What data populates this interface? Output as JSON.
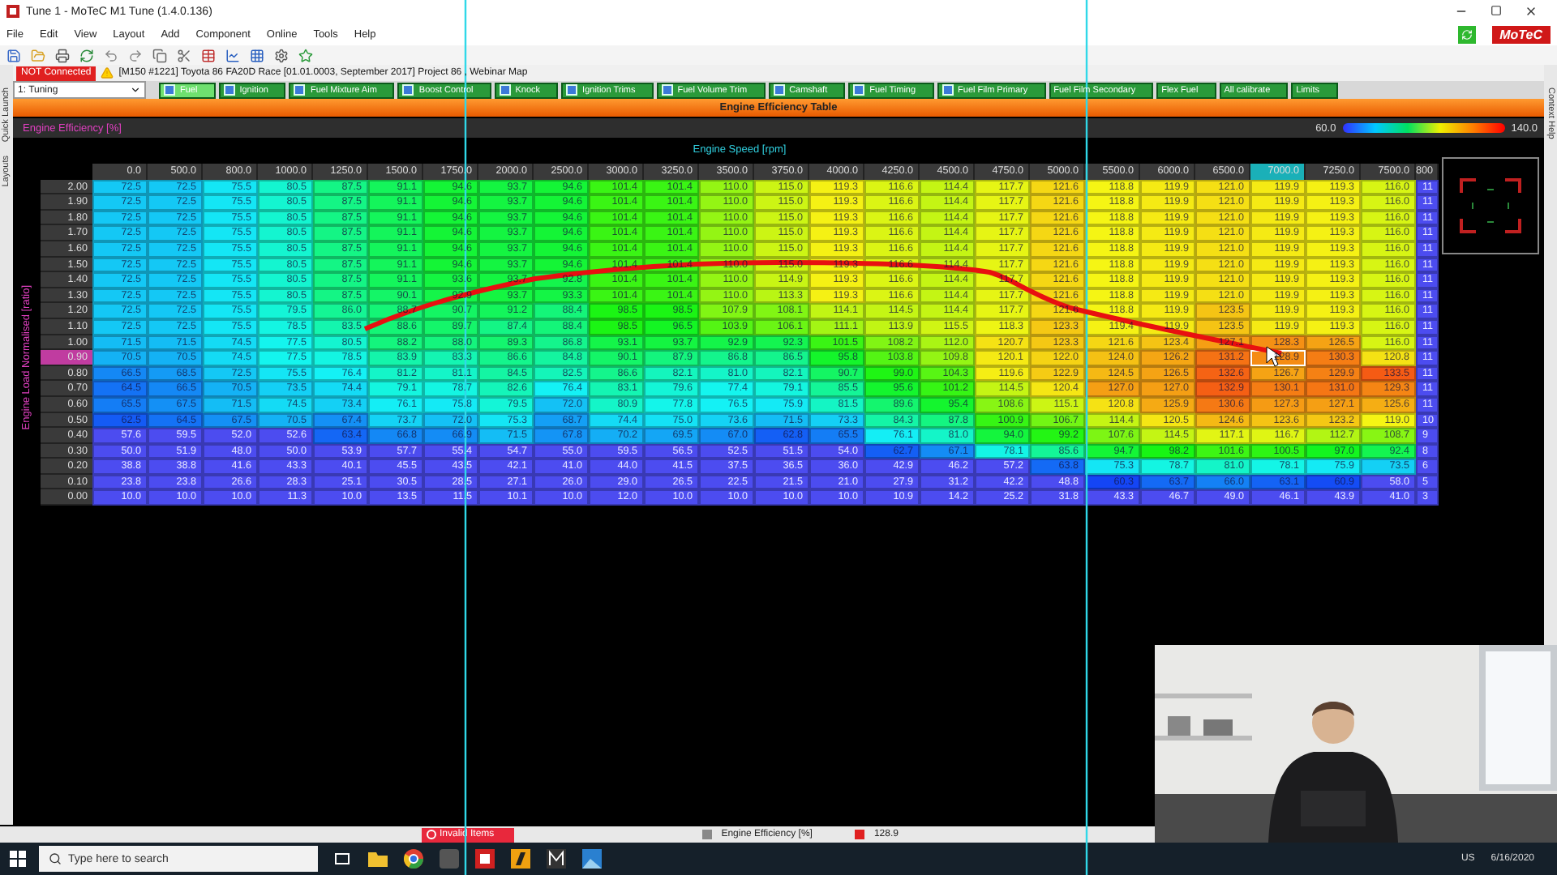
{
  "window": {
    "title": "Tune 1 - MoTeC M1 Tune (1.4.0.136)"
  },
  "menu": [
    "File",
    "Edit",
    "View",
    "Layout",
    "Add",
    "Component",
    "Online",
    "Tools",
    "Help"
  ],
  "brand": "MoTeC",
  "connection": {
    "status": "NOT Connected",
    "details": "[M150 #1221]  Toyota 86 FA20D Race [01.01.0003, September 2017] Project 86 , Webinar Map"
  },
  "side_tabs_left": [
    "Quick Launch",
    "Layouts"
  ],
  "side_tabs_right": [
    "Context Help"
  ],
  "workbook": {
    "value": "1: Tuning"
  },
  "tabs": [
    {
      "label": "Fuel",
      "selected": true,
      "icon": true
    },
    {
      "label": "Ignition",
      "selected": false,
      "icon": true
    },
    {
      "label": "Fuel Mixture Aim",
      "selected": false,
      "icon": true
    },
    {
      "label": "Boost Control",
      "selected": false,
      "icon": true
    },
    {
      "label": "Knock",
      "selected": false,
      "icon": true
    },
    {
      "label": "Ignition Trims",
      "selected": false,
      "icon": true
    },
    {
      "label": "Fuel Volume Trim",
      "selected": false,
      "icon": true
    },
    {
      "label": "Camshaft",
      "selected": false,
      "icon": true
    },
    {
      "label": "Fuel Timing",
      "selected": false,
      "icon": true
    },
    {
      "label": "Fuel Film Primary",
      "selected": false,
      "icon": true
    },
    {
      "label": "Fuel Film Secondary",
      "selected": false,
      "icon": false
    },
    {
      "label": "Flex Fuel",
      "selected": false,
      "icon": false
    },
    {
      "label": "All calibrate",
      "selected": false,
      "icon": false
    },
    {
      "label": "Limits",
      "selected": false,
      "icon": false
    }
  ],
  "table": {
    "title": "Engine Efficiency Table",
    "name": "Engine Efficiency [%]",
    "scale_min": "60.0",
    "scale_max": "140.0",
    "x_axis": "Engine Speed [rpm]",
    "y_axis": "Engine Load Normalised [ratio]",
    "columns": [
      {
        "label": "0.0",
        "selected": false
      },
      {
        "label": "500.0",
        "selected": false
      },
      {
        "label": "800.0",
        "selected": false
      },
      {
        "label": "1000.0",
        "selected": false
      },
      {
        "label": "1250.0",
        "selected": false
      },
      {
        "label": "1500.0",
        "selected": false
      },
      {
        "label": "1750.0",
        "selected": false
      },
      {
        "label": "2000.0",
        "selected": false
      },
      {
        "label": "2500.0",
        "selected": false
      },
      {
        "label": "3000.0",
        "selected": false
      },
      {
        "label": "3250.0",
        "selected": false
      },
      {
        "label": "3500.0",
        "selected": false
      },
      {
        "label": "3750.0",
        "selected": false
      },
      {
        "label": "4000.0",
        "selected": false
      },
      {
        "label": "4250.0",
        "selected": false
      },
      {
        "label": "4500.0",
        "selected": false
      },
      {
        "label": "4750.0",
        "selected": false
      },
      {
        "label": "5000.0",
        "selected": false
      },
      {
        "label": "5500.0",
        "selected": false
      },
      {
        "label": "6000.0",
        "selected": false
      },
      {
        "label": "6500.0",
        "selected": false
      },
      {
        "label": "7000.0",
        "selected": true
      },
      {
        "label": "7250.0",
        "selected": false
      },
      {
        "label": "7500.0",
        "selected": false
      },
      {
        "label": "800",
        "selected": false
      }
    ],
    "rows": [
      {
        "label": "2.00",
        "selected": false,
        "cells": [
          "72.5",
          "72.5",
          "75.5",
          "80.5",
          "87.5",
          "91.1",
          "94.6",
          "93.7",
          "94.6",
          "101.4",
          "101.4",
          "110.0",
          "115.0",
          "119.3",
          "116.6",
          "114.4",
          "117.7",
          "121.6",
          "118.8",
          "119.9",
          "121.0",
          "119.9",
          "119.3",
          "116.0",
          "11"
        ]
      },
      {
        "label": "1.90",
        "selected": false,
        "cells": [
          "72.5",
          "72.5",
          "75.5",
          "80.5",
          "87.5",
          "91.1",
          "94.6",
          "93.7",
          "94.6",
          "101.4",
          "101.4",
          "110.0",
          "115.0",
          "119.3",
          "116.6",
          "114.4",
          "117.7",
          "121.6",
          "118.8",
          "119.9",
          "121.0",
          "119.9",
          "119.3",
          "116.0",
          "11"
        ]
      },
      {
        "label": "1.80",
        "selected": false,
        "cells": [
          "72.5",
          "72.5",
          "75.5",
          "80.5",
          "87.5",
          "91.1",
          "94.6",
          "93.7",
          "94.6",
          "101.4",
          "101.4",
          "110.0",
          "115.0",
          "119.3",
          "116.6",
          "114.4",
          "117.7",
          "121.6",
          "118.8",
          "119.9",
          "121.0",
          "119.9",
          "119.3",
          "116.0",
          "11"
        ]
      },
      {
        "label": "1.70",
        "selected": false,
        "cells": [
          "72.5",
          "72.5",
          "75.5",
          "80.5",
          "87.5",
          "91.1",
          "94.6",
          "93.7",
          "94.6",
          "101.4",
          "101.4",
          "110.0",
          "115.0",
          "119.3",
          "116.6",
          "114.4",
          "117.7",
          "121.6",
          "118.8",
          "119.9",
          "121.0",
          "119.9",
          "119.3",
          "116.0",
          "11"
        ]
      },
      {
        "label": "1.60",
        "selected": false,
        "cells": [
          "72.5",
          "72.5",
          "75.5",
          "80.5",
          "87.5",
          "91.1",
          "94.6",
          "93.7",
          "94.6",
          "101.4",
          "101.4",
          "110.0",
          "115.0",
          "119.3",
          "116.6",
          "114.4",
          "117.7",
          "121.6",
          "118.8",
          "119.9",
          "121.0",
          "119.9",
          "119.3",
          "116.0",
          "11"
        ]
      },
      {
        "label": "1.50",
        "selected": false,
        "cells": [
          "72.5",
          "72.5",
          "75.5",
          "80.5",
          "87.5",
          "91.1",
          "94.6",
          "93.7",
          "94.6",
          "101.4",
          "101.4",
          "110.0",
          "115.0",
          "119.3",
          "116.6",
          "114.4",
          "117.7",
          "121.6",
          "118.8",
          "119.9",
          "121.0",
          "119.9",
          "119.3",
          "116.0",
          "11"
        ]
      },
      {
        "label": "1.40",
        "selected": false,
        "cells": [
          "72.5",
          "72.5",
          "75.5",
          "80.5",
          "87.5",
          "91.1",
          "93.6",
          "93.7",
          "92.8",
          "101.4",
          "101.4",
          "110.0",
          "114.9",
          "119.3",
          "116.6",
          "114.4",
          "117.7",
          "121.6",
          "118.8",
          "119.9",
          "121.0",
          "119.9",
          "119.3",
          "116.0",
          "11"
        ]
      },
      {
        "label": "1.30",
        "selected": false,
        "cells": [
          "72.5",
          "72.5",
          "75.5",
          "80.5",
          "87.5",
          "90.1",
          "92.9",
          "93.7",
          "93.3",
          "101.4",
          "101.4",
          "110.0",
          "113.3",
          "119.3",
          "116.6",
          "114.4",
          "117.7",
          "121.6",
          "118.8",
          "119.9",
          "121.0",
          "119.9",
          "119.3",
          "116.0",
          "11"
        ]
      },
      {
        "label": "1.20",
        "selected": false,
        "cells": [
          "72.5",
          "72.5",
          "75.5",
          "79.5",
          "86.0",
          "88.7",
          "90.7",
          "91.2",
          "88.4",
          "98.5",
          "98.5",
          "107.9",
          "108.1",
          "114.1",
          "114.5",
          "114.4",
          "117.7",
          "121.6",
          "118.8",
          "119.9",
          "123.5",
          "119.9",
          "119.3",
          "116.0",
          "11"
        ]
      },
      {
        "label": "1.10",
        "selected": false,
        "cells": [
          "72.5",
          "72.5",
          "75.5",
          "78.5",
          "83.5",
          "88.6",
          "89.7",
          "87.4",
          "88.4",
          "98.5",
          "96.5",
          "103.9",
          "106.1",
          "111.1",
          "113.9",
          "115.5",
          "118.3",
          "123.3",
          "119.4",
          "119.9",
          "123.5",
          "119.9",
          "119.3",
          "116.0",
          "11"
        ]
      },
      {
        "label": "1.00",
        "selected": false,
        "cells": [
          "71.5",
          "71.5",
          "74.5",
          "77.5",
          "80.5",
          "88.2",
          "88.0",
          "89.3",
          "86.8",
          "93.1",
          "93.7",
          "92.9",
          "92.3",
          "101.5",
          "108.2",
          "112.0",
          "120.7",
          "123.3",
          "121.6",
          "123.4",
          "127.1",
          "128.3",
          "126.5",
          "116.0",
          "11"
        ]
      },
      {
        "label": "0.90",
        "selected": true,
        "cells": [
          "70.5",
          "70.5",
          "74.5",
          "77.5",
          "78.5",
          "83.9",
          "83.3",
          "86.6",
          "84.8",
          "90.1",
          "87.9",
          "86.8",
          "86.5",
          "95.8",
          "103.8",
          "109.8",
          "120.1",
          "122.0",
          "124.0",
          "126.2",
          "131.2",
          "128.9",
          "130.3",
          "120.8",
          "11"
        ]
      },
      {
        "label": "0.80",
        "selected": false,
        "cells": [
          "66.5",
          "68.5",
          "72.5",
          "75.5",
          "76.4",
          "81.2",
          "81.1",
          "84.5",
          "82.5",
          "86.6",
          "82.1",
          "81.0",
          "82.1",
          "90.7",
          "99.0",
          "104.3",
          "119.6",
          "122.9",
          "124.5",
          "126.5",
          "132.6",
          "126.7",
          "129.9",
          "133.5",
          "11"
        ]
      },
      {
        "label": "0.70",
        "selected": false,
        "cells": [
          "64.5",
          "66.5",
          "70.5",
          "73.5",
          "74.4",
          "79.1",
          "78.7",
          "82.6",
          "76.4",
          "83.1",
          "79.6",
          "77.4",
          "79.1",
          "85.5",
          "95.6",
          "101.2",
          "114.5",
          "120.4",
          "127.0",
          "127.0",
          "132.9",
          "130.1",
          "131.0",
          "129.3",
          "11"
        ]
      },
      {
        "label": "0.60",
        "selected": false,
        "cells": [
          "65.5",
          "67.5",
          "71.5",
          "74.5",
          "73.4",
          "76.1",
          "75.8",
          "79.5",
          "72.0",
          "80.9",
          "77.8",
          "76.5",
          "75.9",
          "81.5",
          "89.6",
          "95.4",
          "108.6",
          "115.1",
          "120.8",
          "125.9",
          "130.6",
          "127.3",
          "127.1",
          "125.6",
          "11"
        ]
      },
      {
        "label": "0.50",
        "selected": false,
        "cells": [
          "62.5",
          "64.5",
          "67.5",
          "70.5",
          "67.4",
          "73.7",
          "72.0",
          "75.3",
          "68.7",
          "74.4",
          "75.0",
          "73.6",
          "71.5",
          "73.3",
          "84.3",
          "87.8",
          "100.9",
          "106.7",
          "114.4",
          "120.5",
          "124.6",
          "123.6",
          "123.2",
          "119.0",
          "10"
        ]
      },
      {
        "label": "0.40",
        "selected": false,
        "cells": [
          "57.6",
          "59.5",
          "52.0",
          "52.6",
          "63.4",
          "66.8",
          "66.9",
          "71.5",
          "67.8",
          "70.2",
          "69.5",
          "67.0",
          "62.8",
          "65.5",
          "76.1",
          "81.0",
          "94.0",
          "99.2",
          "107.6",
          "114.5",
          "117.1",
          "116.7",
          "112.7",
          "108.7",
          "9"
        ]
      },
      {
        "label": "0.30",
        "selected": false,
        "cells": [
          "50.0",
          "51.9",
          "48.0",
          "50.0",
          "53.9",
          "57.7",
          "55.4",
          "54.7",
          "55.0",
          "59.5",
          "56.5",
          "52.5",
          "51.5",
          "54.0",
          "62.7",
          "67.1",
          "78.1",
          "85.6",
          "94.7",
          "98.2",
          "101.6",
          "100.5",
          "97.0",
          "92.4",
          "8"
        ]
      },
      {
        "label": "0.20",
        "selected": false,
        "cells": [
          "38.8",
          "38.8",
          "41.6",
          "43.3",
          "40.1",
          "45.5",
          "43.5",
          "42.1",
          "41.0",
          "44.0",
          "41.5",
          "37.5",
          "36.5",
          "36.0",
          "42.9",
          "46.2",
          "57.2",
          "63.8",
          "75.3",
          "78.7",
          "81.0",
          "78.1",
          "75.9",
          "73.5",
          "6"
        ]
      },
      {
        "label": "0.10",
        "selected": false,
        "cells": [
          "23.8",
          "23.8",
          "26.6",
          "28.3",
          "25.1",
          "30.5",
          "28.5",
          "27.1",
          "26.0",
          "29.0",
          "26.5",
          "22.5",
          "21.5",
          "21.0",
          "27.9",
          "31.2",
          "42.2",
          "48.8",
          "60.3",
          "63.7",
          "66.0",
          "63.1",
          "60.9",
          "58.0",
          "5"
        ]
      },
      {
        "label": "0.00",
        "selected": false,
        "cells": [
          "10.0",
          "10.0",
          "10.0",
          "11.3",
          "10.0",
          "13.5",
          "11.5",
          "10.1",
          "10.0",
          "12.0",
          "10.0",
          "10.0",
          "10.0",
          "10.0",
          "10.9",
          "14.2",
          "25.2",
          "31.8",
          "43.3",
          "46.7",
          "49.0",
          "46.1",
          "43.9",
          "41.0",
          "3"
        ]
      }
    ]
  },
  "status_bar": {
    "invalid": "Invalid Items",
    "channel": "Engine Efficiency [%]",
    "value": "128.9"
  },
  "taskbar": {
    "search_placeholder": "Type here to search",
    "locale": "US",
    "date": "6/16/2020"
  }
}
